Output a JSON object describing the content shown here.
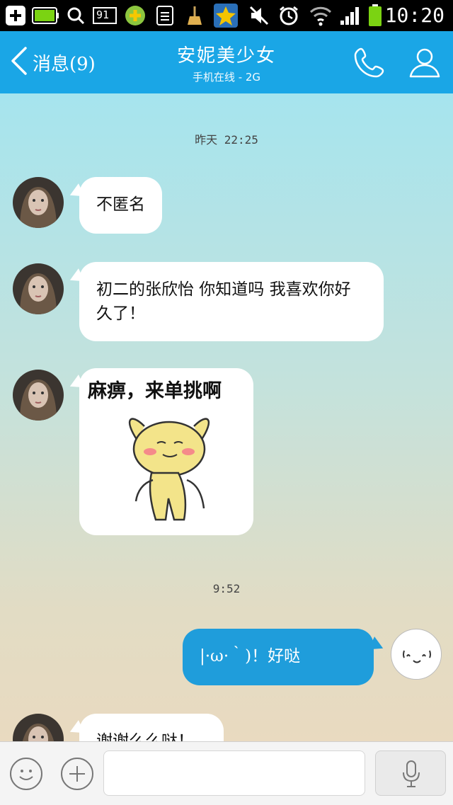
{
  "status_bar": {
    "time": "10:20",
    "notification_count": "91",
    "icons": [
      "add-icon",
      "battery-notification-icon",
      "search-icon",
      "notification-count-icon",
      "plus-app-icon",
      "document-icon",
      "broom-icon",
      "star-app-icon",
      "mute-icon",
      "alarm-icon",
      "wifi-icon",
      "signal-icon",
      "battery-icon"
    ]
  },
  "header": {
    "back_label": "消息(9)",
    "title": "安妮美少女",
    "subtitle": "手机在线 - 2G",
    "call_icon": "phone-icon",
    "profile_icon": "person-icon"
  },
  "chat": {
    "timestamps": [
      "昨天 22:25",
      "9:52"
    ],
    "messages": [
      {
        "side": "left",
        "text": "不匿名"
      },
      {
        "side": "left",
        "text": "初二的张欣怡 你知道吗 我喜欢你好久了！"
      },
      {
        "side": "left",
        "type": "sticker",
        "text": "麻痹，来单挑啊"
      },
      {
        "side": "right",
        "text": "|·ω·｀)！好哒"
      },
      {
        "side": "left",
        "text": "谢谢么么哒！"
      }
    ]
  },
  "input_bar": {
    "emoji_icon": "smiley-icon",
    "add_icon": "plus-circle-icon",
    "voice_icon": "microphone-icon",
    "placeholder": ""
  },
  "colors": {
    "header_bg": "#1aa6e6",
    "outgoing_bubble": "#1f9ddb",
    "incoming_bubble": "#ffffff"
  }
}
